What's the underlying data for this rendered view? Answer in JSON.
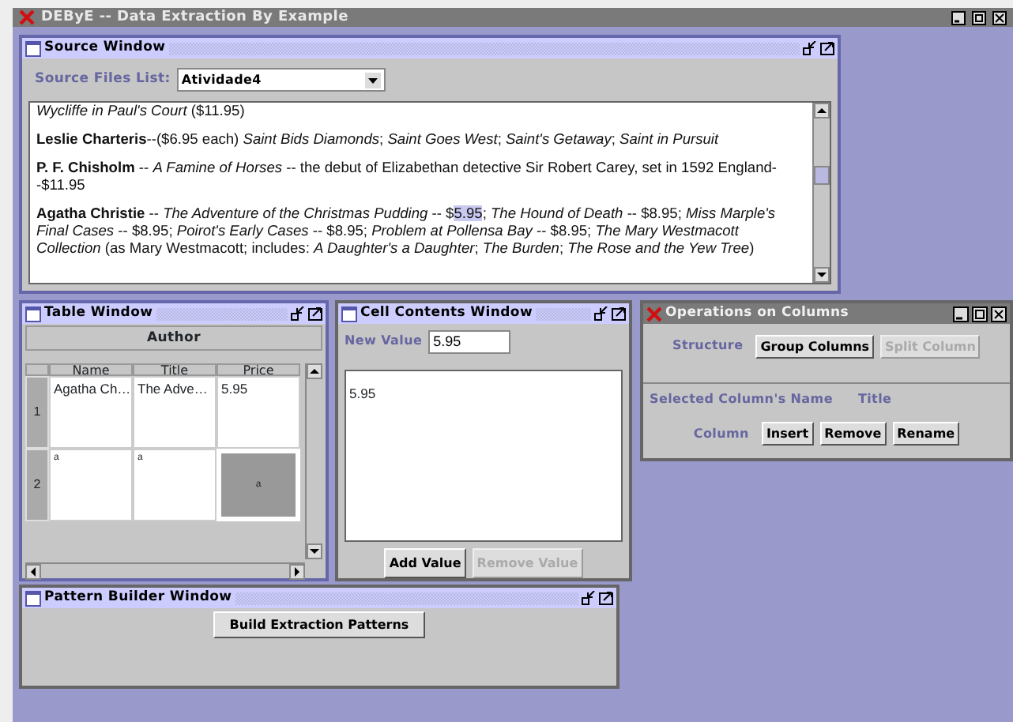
{
  "app": {
    "title": "DEByE -- Data Extraction By Example"
  },
  "source_window": {
    "title": "Source Window",
    "files_label": "Source Files List:",
    "file": "Atividade4",
    "paragraphs": [
      {
        "parts": [
          {
            "text": "*Wycliffe in Paul's Court* ($11.95)",
            "selected": false
          }
        ]
      },
      {
        "parts": [
          {
            "text": "**Leslie Charteris**--($6.95 each) *Saint Bids Diamonds*; *Saint Goes West*; *Saint's Getaway*; *Saint in Pursuit*",
            "selected": false
          }
        ]
      },
      {
        "parts": [
          {
            "text": "**P. F. Chisholm** -- *A Famine of Horses* -- the debut of Elizabethan detective Sir Robert Carey, set in 1592 England--$11.95",
            "selected": false
          }
        ]
      },
      {
        "parts": [
          {
            "text": "**Agatha Christie** -- *The Adventure of the Christmas Pudding* -- $",
            "selected": false
          },
          {
            "text": "5.95",
            "selected": true
          },
          {
            "text": "; *The Hound of Death* -- $8.95; *Miss Marple's Final Cases* -- $8.95; *Poirot's Early Cases* -- $8.95; *Problem at Pollensa Bay* -- $8.95; *The Mary Westmacott Collection* (as Mary Westmacott; includes: *A Daughter's a Daughter*; *The Burden*; *The Rose and the Yew Tree*)",
            "selected": false
          }
        ]
      }
    ]
  },
  "table_window": {
    "title": "Table Window",
    "group_header": "Author",
    "columns": [
      "Name",
      "Title",
      "Price"
    ],
    "rows": [
      {
        "number": "1",
        "cells": [
          {
            "text": "Agatha Ch…",
            "selected": false
          },
          {
            "text": "The Adve…",
            "selected": false
          },
          {
            "text": "5.95",
            "selected": false
          }
        ]
      },
      {
        "number": "2",
        "cells": [
          {
            "text": "a",
            "selected": false
          },
          {
            "text": "a",
            "selected": false
          },
          {
            "text": "a",
            "selected": true
          }
        ]
      }
    ]
  },
  "cell_window": {
    "title": "Cell Contents Window",
    "new_value_label": "New Value",
    "new_value": "5.95",
    "contents": "5.95",
    "buttons": [
      {
        "label": "Add Value",
        "disabled": false
      },
      {
        "label": "Remove Value",
        "disabled": true
      }
    ]
  },
  "operations": {
    "title": "Operations on Columns",
    "structure_label": "Structure",
    "structure_buttons": [
      {
        "label": "Group Columns",
        "disabled": false
      },
      {
        "label": "Split Column",
        "disabled": true
      }
    ],
    "selected_name_label": "Selected Column's Name",
    "selected_name": "Title",
    "column_label": "Column",
    "column_buttons": [
      {
        "label": "Insert",
        "disabled": false
      },
      {
        "label": "Remove",
        "disabled": false
      },
      {
        "label": "Rename",
        "disabled": false
      }
    ]
  },
  "pattern_window": {
    "title": "Pattern Builder Window",
    "button": "Build Extraction Patterns"
  }
}
